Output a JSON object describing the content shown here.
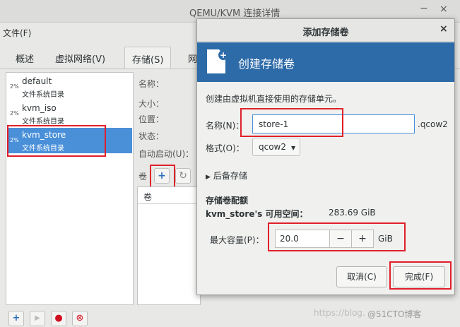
{
  "window": {
    "title": "QEMU/KVM 连接详情",
    "min_glyph": "−",
    "close_glyph": "×",
    "menu_file": "文件(F)"
  },
  "tabs": [
    {
      "label": "概述"
    },
    {
      "label": "虚拟网络(V)"
    },
    {
      "label": "存储(S)"
    },
    {
      "label": "网"
    }
  ],
  "pools": [
    {
      "percent": "2%",
      "name": "default",
      "type": "文件系统目录"
    },
    {
      "percent": "2%",
      "name": "kvm_iso",
      "type": "文件系统目录"
    },
    {
      "percent": "2%",
      "name": "kvm_store",
      "type": "文件系统目录"
    }
  ],
  "details": {
    "name_label": "名称：",
    "size_label": "大小：",
    "location_label": "位置：",
    "state_label": "状态：",
    "autostart_label": "自动启动(U)："
  },
  "volumes": {
    "toolbar_label": "卷",
    "add_glyph": "+",
    "refresh_glyph": "↻",
    "column_header": "卷"
  },
  "bottom_toolbar": {
    "add": "+",
    "play": "▶",
    "stop": "●",
    "delete": "⊗"
  },
  "watermark": {
    "url": "https://blog.",
    "brand": "@51CTO博客"
  },
  "dialog": {
    "title": "添加存储卷",
    "close_glyph": "×",
    "banner_title": "创建存储卷",
    "description": "创建由虚拟机直接使用的存储单元。",
    "name_label": "名称(N)：",
    "name_value": "store-1",
    "name_suffix": ".qcow2",
    "format_label": "格式(O)：",
    "format_value": "qcow2",
    "backing_label": "后备存储",
    "config_heading": "存储卷配额",
    "available_label": "kvm_store's 可用空间：",
    "available_value": "283.69 GiB",
    "capacity_label": "最大容量(P)：",
    "capacity_value": "20.0",
    "minus": "−",
    "plus": "+",
    "unit": "GiB",
    "cancel_label": "取消(C)",
    "finish_label": "完成(F)"
  },
  "colors": {
    "accent": "#2d6aa8",
    "selection": "#4a90d9",
    "annotation": "#e0202a"
  }
}
